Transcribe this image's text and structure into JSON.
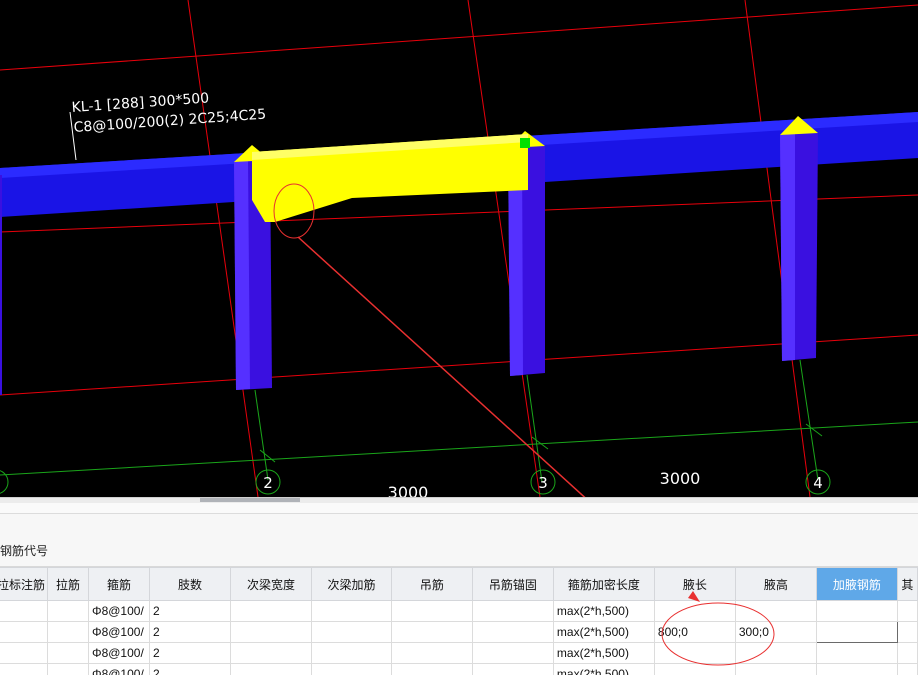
{
  "viewport": {
    "beam_label_line1": "KL-1 [288] 300*500",
    "beam_label_line2": "C8@100/200(2) 2C25;4C25",
    "dim_label_1": "3000",
    "dim_label_2": "3000",
    "axis_labels": [
      "2",
      "3",
      "4"
    ],
    "colors": {
      "background": "#000000",
      "grid_red": "#e8000b",
      "grid_green": "#1aa51a",
      "beam_blue": "#1a14e6",
      "column_purple": "#3a10e0",
      "haunch_yellow": "#ffff00",
      "annotation_red": "#e83030"
    }
  },
  "panel": {
    "title": "钢筋代号",
    "table": {
      "headers": [
        "拉标注筋",
        "拉筋",
        "箍筋",
        "肢数",
        "次梁宽度",
        "次梁加筋",
        "吊筋",
        "吊筋锚固",
        "箍筋加密长度",
        "腋长",
        "腋高",
        "加腋钢筋",
        "其"
      ],
      "active_header": "加腋钢筋",
      "rows": [
        [
          "",
          "",
          "Φ8@100/",
          "2",
          "",
          "",
          "",
          "",
          "max(2*h,500)",
          "",
          "",
          "",
          ""
        ],
        [
          "",
          "",
          "Φ8@100/",
          "2",
          "",
          "",
          "",
          "",
          "max(2*h,500)",
          "800;0",
          "300;0",
          "",
          ""
        ],
        [
          "",
          "",
          "Φ8@100/",
          "2",
          "",
          "",
          "",
          "",
          "max(2*h,500)",
          "",
          "",
          "",
          ""
        ],
        [
          "",
          "",
          "Φ8@100/",
          "2",
          "",
          "",
          "",
          "",
          "max(2*h,500)",
          "",
          "",
          "",
          ""
        ]
      ]
    }
  }
}
